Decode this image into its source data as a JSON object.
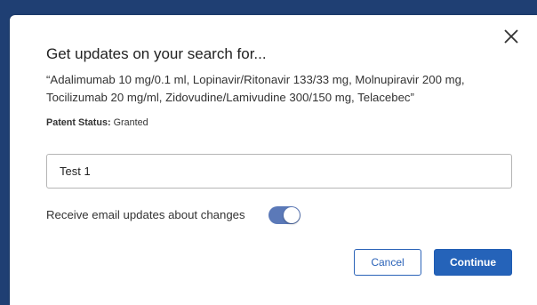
{
  "colors": {
    "primary": "#2563b9",
    "toggle_on": "#5b79b8",
    "backdrop": "#1f3f73"
  },
  "modal": {
    "title": "Get updates on your search for...",
    "query_text": "“Adalimumab 10 mg/0.1 ml, Lopinavir/Ritonavir 133/33 mg, Molnupiravir 200 mg, Tocilizumab 20 mg/ml, Zidovudine/Lamivudine 300/150 mg, Telacebec”",
    "patent_status_label": "Patent Status:",
    "patent_status_value": "Granted",
    "name_input_value": "Test 1",
    "email_toggle_label": "Receive email updates about changes",
    "email_toggle_on": true,
    "cancel_label": "Cancel",
    "continue_label": "Continue",
    "close_icon": "close-icon"
  }
}
